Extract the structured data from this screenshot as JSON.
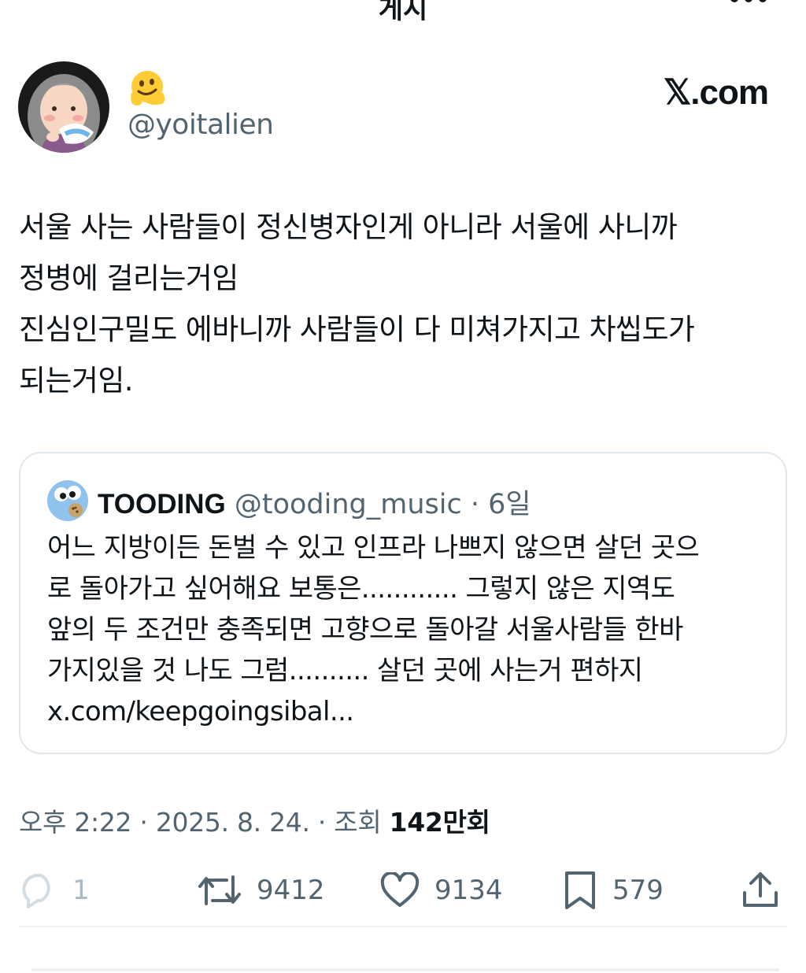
{
  "header": {
    "title": "게시",
    "back_icon": "back-arrow-icon",
    "more_icon": "more-dots-icon"
  },
  "author": {
    "handle": "@yoitalien",
    "display_name_emoji": "melting-face-emoji",
    "avatar": "illustrated-grandmother-eating-shaved-ice"
  },
  "source_badge": {
    "mark": "𝕏",
    "text": ".com"
  },
  "tweet": {
    "text": "서울 사는 사람들이 정신병자인게 아니라 서울에 사니까\n정병에 걸리는거임\n진심인구밀도 에바니까 사람들이 다 미쳐가지고 차씹도가\n되는거임."
  },
  "quote": {
    "name": "TOODING",
    "handle": "@tooding_music",
    "separator": "·",
    "time": "6일",
    "avatar": "blue-monster-cookie-avatar",
    "text": "어느 지방이든 돈벌 수 있고 인프라 나쁘지 않으면 살던 곳으\n로 돌아가고 싶어해요 보통은............ 그렇지 않은 지역도\n앞의 두 조건만 충족되면 고향으로 돌아갈 서울사람들 한바\n가지있을 것 나도 그럼.......... 살던 곳에 사는거 편하지\nx.com/keepgoingsibal..."
  },
  "meta": {
    "time": "오후 2:22",
    "sep1": "·",
    "date": "2025. 8. 24.",
    "sep2": "·",
    "views_label": "조회",
    "views_count": "142만",
    "views_unit": "회"
  },
  "actions": {
    "reply_count": "1",
    "retweet_count": "9412",
    "like_count": "9134",
    "bookmark_count": "579"
  },
  "colors": {
    "text_primary": "#0f1419",
    "text_secondary": "#536471",
    "border": "#e1e8ed"
  }
}
